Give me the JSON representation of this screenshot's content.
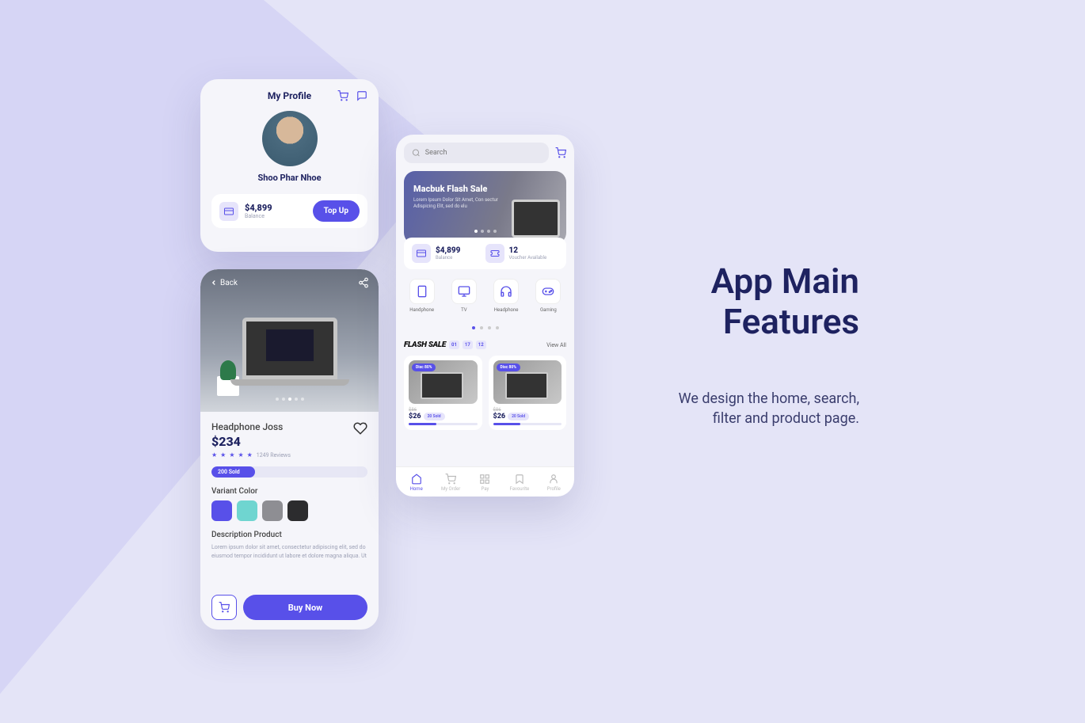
{
  "headline": {
    "line1": "App Main",
    "line2": "Features",
    "desc1": "We design the home, search,",
    "desc2": "filter and product page."
  },
  "profile": {
    "header_title": "My Profile",
    "name": "Shoo Phar Nhoe",
    "balance": "$4,899",
    "balance_label": "Balance",
    "topup_label": "Top Up"
  },
  "product": {
    "back_label": "Back",
    "title": "Headphone Joss",
    "price": "$234",
    "reviews": "1249 Reviews",
    "sold": "200 Sold",
    "variant_header": "Variant Color",
    "colors": [
      "#5850e9",
      "#6fd5d0",
      "#8e8e93",
      "#2c2c2e"
    ],
    "desc_header": "Description Product",
    "desc": "Lorem ipsum dolor sit amet, consectetur adipiscing elit, sed do eiusmod tempor incididunt ut labore et dolore magna aliqua. Ut",
    "buy_label": "Buy Now"
  },
  "home": {
    "search_placeholder": "Search",
    "banner_title": "Macbuk Flash Sale",
    "banner_sub": "Lorem Ipsum Dolor Sit Amet, Con sectur Adispicing Elit, sed do elu",
    "balance": "$4,899",
    "balance_label": "Balance",
    "voucher_count": "12",
    "voucher_label": "Voucher Available",
    "categories": [
      "Handphone",
      "TV",
      "Headphone",
      "Gaming"
    ],
    "flash_title": "FLASH SALE",
    "timer": [
      "01",
      "17",
      "12"
    ],
    "view_all": "View All",
    "products": [
      {
        "disc": "Disc 80%",
        "old": "$86",
        "price": "$26",
        "sold": "20 Sold"
      },
      {
        "disc": "Disc 80%",
        "old": "$86",
        "price": "$26",
        "sold": "20 Sold"
      }
    ],
    "tabs": [
      "Home",
      "My Order",
      "Pay",
      "Favourite",
      "Profile"
    ]
  }
}
